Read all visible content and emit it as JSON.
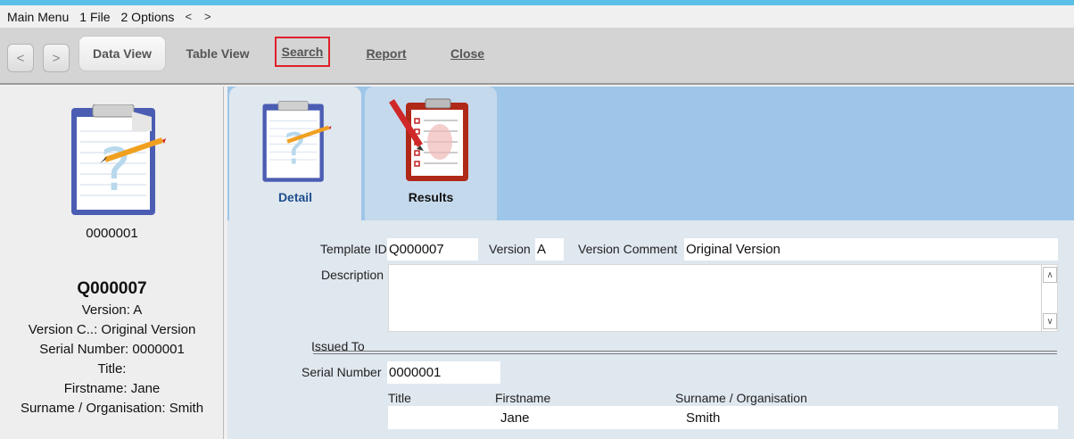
{
  "menu": {
    "items": [
      "Main Menu",
      "1 File",
      "2 Options"
    ],
    "back": "<",
    "forward": ">"
  },
  "toolbar": {
    "nav_back": "<",
    "nav_forward": ">",
    "data_view": "Data View",
    "table_view": "Table View",
    "search": "Search",
    "report": "Report",
    "close": "Close"
  },
  "sidebar": {
    "serial": "0000001",
    "template_id": "Q000007",
    "version_line": "Version: A",
    "version_comment_line": "Version C..: Original Version",
    "serial_line": "Serial Number: 0000001",
    "title_line": "Title:",
    "firstname_line": "Firstname: Jane",
    "surname_line": "Surname / Organisation: Smith"
  },
  "tabs": {
    "detail": "Detail",
    "results": "Results"
  },
  "form": {
    "template_id_label": "Template ID",
    "template_id": "Q000007",
    "version_label": "Version",
    "version": "A",
    "version_comment_label": "Version Comment",
    "version_comment": "Original Version",
    "description_label": "Description",
    "description": "",
    "issued_to_label": "Issued To",
    "serial_number_label": "Serial Number",
    "serial_number": "0000001",
    "title_label": "Title",
    "firstname_label": "Firstname",
    "surname_label": "Surname / Organisation",
    "title": "",
    "firstname": "Jane",
    "surname": "Smith"
  },
  "colors": {
    "accent_strip": "#5bc0e8",
    "search_highlight": "#e0202a",
    "pane_blue": "#9ec6e8"
  }
}
